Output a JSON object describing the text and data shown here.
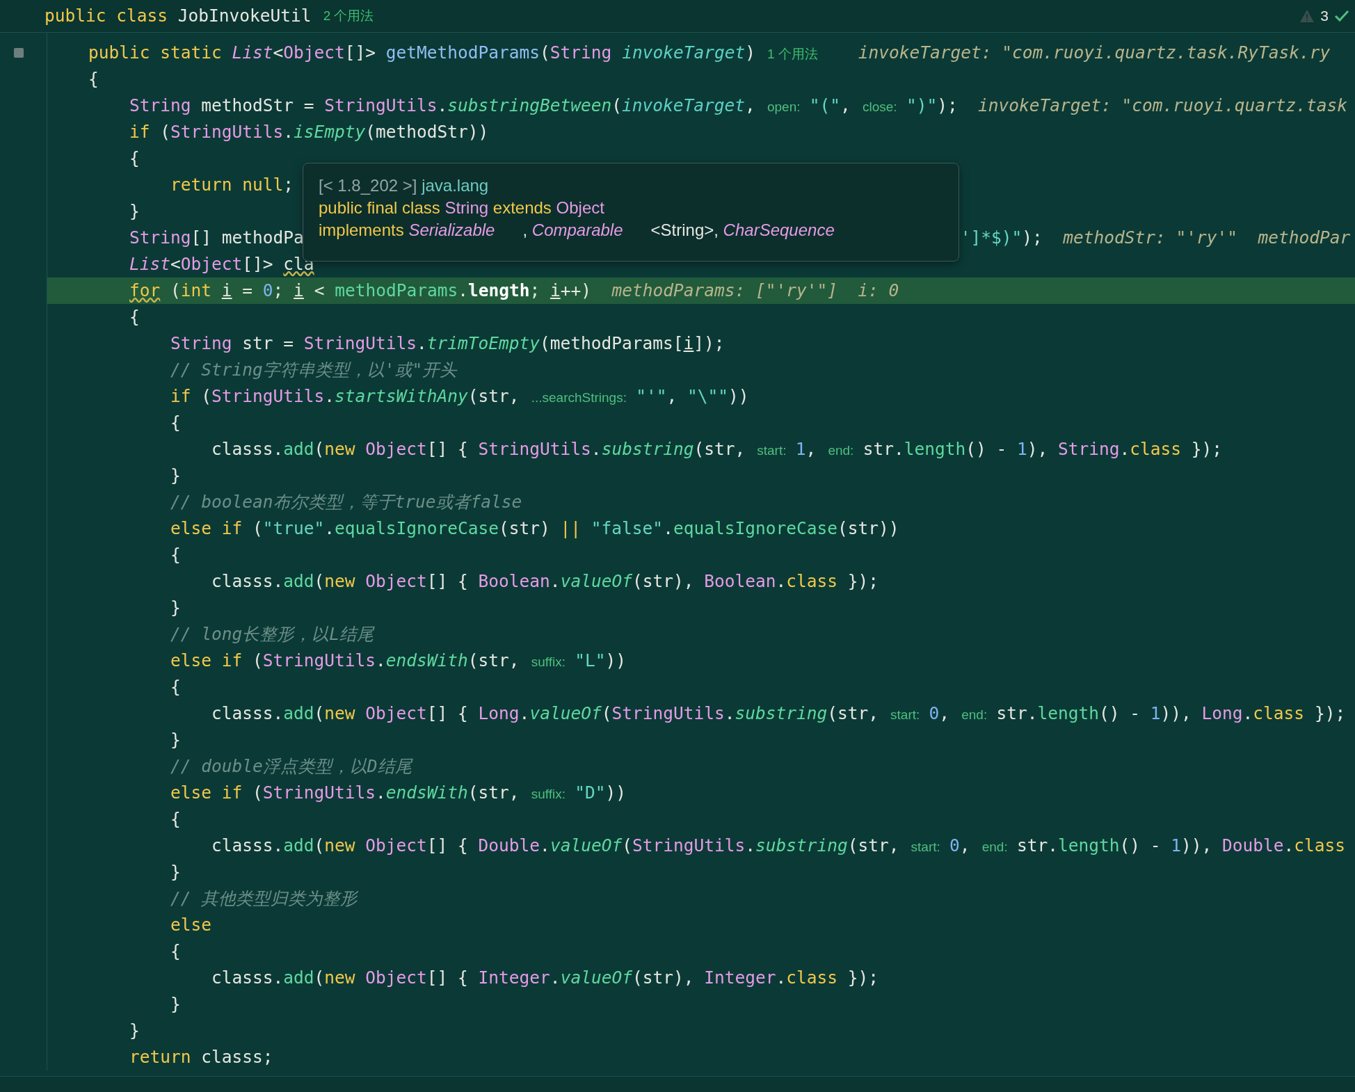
{
  "header": {
    "code": [
      {
        "kind": "kw",
        "text": "public class "
      },
      {
        "kind": "plain",
        "text": "JobInvokeUtil"
      }
    ],
    "usages": "2 个用法",
    "problems": "3"
  },
  "tooltip": {
    "lines": [
      [
        {
          "kind": "dim",
          "text": "[< 1.8_202 >] "
        },
        {
          "kind": "pkg",
          "text": "java.lang"
        }
      ],
      [
        {
          "kind": "kw",
          "text": "public final class "
        },
        {
          "kind": "type",
          "text": "String"
        },
        {
          "kind": "kw",
          "text": " extends "
        },
        {
          "kind": "type",
          "text": "Object"
        }
      ],
      [
        {
          "kind": "kw",
          "text": "implements "
        },
        {
          "kind": "itype",
          "text": "Serializable"
        },
        {
          "kind": "plain",
          "text": "      , "
        },
        {
          "kind": "itype",
          "text": "Comparable"
        },
        {
          "kind": "plain",
          "text": "      <String>, "
        },
        {
          "kind": "itype",
          "text": "CharSequence"
        }
      ]
    ]
  },
  "lines": [
    {
      "highlighted": false,
      "tokens": [
        {
          "kind": "kw",
          "text": "public static "
        },
        {
          "kind": "itype",
          "text": "List"
        },
        {
          "kind": "plain",
          "text": "<"
        },
        {
          "kind": "type",
          "text": "Object"
        },
        {
          "kind": "plain",
          "text": "[]> "
        },
        {
          "kind": "fn",
          "text": "getMethodParams"
        },
        {
          "kind": "plain",
          "text": "("
        },
        {
          "kind": "type",
          "text": "String "
        },
        {
          "kind": "param",
          "text": "invokeTarget"
        },
        {
          "kind": "plain",
          "text": ")"
        },
        {
          "kind": "usage",
          "text": "1 个用法"
        },
        {
          "kind": "dbg",
          "text": "invokeTarget: \"com.ruoyi.quartz.task.RyTask.ry"
        }
      ]
    },
    {
      "highlighted": false,
      "tokens": [
        {
          "kind": "plain",
          "text": "{"
        }
      ],
      "children": [
        {
          "highlighted": false,
          "tokens": [
            {
              "kind": "type",
              "text": "String"
            },
            {
              "kind": "plain",
              "text": " methodStr = "
            },
            {
              "kind": "type",
              "text": "StringUtils"
            },
            {
              "kind": "plain",
              "text": "."
            },
            {
              "kind": "scall",
              "text": "substringBetween"
            },
            {
              "kind": "plain",
              "text": "("
            },
            {
              "kind": "param",
              "text": "invokeTarget"
            },
            {
              "kind": "plain",
              "text": ","
            },
            {
              "kind": "hint",
              "text": "open:"
            },
            {
              "kind": "str",
              "text": "\"(\""
            },
            {
              "kind": "plain",
              "text": ","
            },
            {
              "kind": "hint",
              "text": "close:"
            },
            {
              "kind": "str",
              "text": "\")\""
            },
            {
              "kind": "plain",
              "text": ");"
            },
            {
              "kind": "dbg",
              "text": "invokeTarget: \"com.ruoyi.quartz.task"
            }
          ]
        },
        {
          "highlighted": false,
          "tokens": [
            {
              "kind": "kw",
              "text": "if"
            },
            {
              "kind": "plain",
              "text": " ("
            },
            {
              "kind": "type",
              "text": "StringUtils"
            },
            {
              "kind": "plain",
              "text": "."
            },
            {
              "kind": "scall",
              "text": "isEmpty"
            },
            {
              "kind": "plain",
              "text": "(methodStr))"
            }
          ]
        },
        {
          "highlighted": false,
          "tokens": [
            {
              "kind": "plain",
              "text": "{"
            }
          ],
          "children": [
            {
              "highlighted": false,
              "tokens": [
                {
                  "kind": "kw",
                  "text": "return null"
                },
                {
                  "kind": "plain",
                  "text": ";"
                }
              ]
            }
          ]
        },
        {
          "highlighted": false,
          "tokens": [
            {
              "kind": "plain",
              "text": "}"
            }
          ]
        },
        {
          "highlighted": false,
          "tokens": [
            {
              "kind": "type",
              "text": "String"
            },
            {
              "kind": "plain",
              "text": "[] methodPa"
            },
            {
              "kind": "resume",
              "text": "']*$)\""
            },
            {
              "kind": "plain",
              "text": ");"
            },
            {
              "kind": "dbg",
              "text": "methodStr: \"'ry'\""
            },
            {
              "kind": "dbg",
              "text": "methodPar"
            }
          ]
        },
        {
          "highlighted": false,
          "tokens": [
            {
              "kind": "itype",
              "text": "List"
            },
            {
              "kind": "plain",
              "text": "<"
            },
            {
              "kind": "type",
              "text": "Object"
            },
            {
              "kind": "plain",
              "text": "[]> "
            },
            {
              "kind": "warn",
              "text": "cla"
            }
          ]
        },
        {
          "highlighted": true,
          "tokens": [
            {
              "kind": "warnkw",
              "text": "for"
            },
            {
              "kind": "plain",
              "text": " ("
            },
            {
              "kind": "kw",
              "text": "int "
            },
            {
              "kind": "local",
              "text": "i"
            },
            {
              "kind": "plain",
              "text": " = "
            },
            {
              "kind": "num",
              "text": "0"
            },
            {
              "kind": "plain",
              "text": "; "
            },
            {
              "kind": "local",
              "text": "i"
            },
            {
              "kind": "plain",
              "text": " < "
            },
            {
              "kind": "call",
              "text": "methodParams"
            },
            {
              "kind": "plain",
              "text": "."
            },
            {
              "kind": "field",
              "text": "length"
            },
            {
              "kind": "plain",
              "text": "; "
            },
            {
              "kind": "local",
              "text": "i"
            },
            {
              "kind": "plain",
              "text": "++)"
            },
            {
              "kind": "dbg",
              "text": "methodParams: [\"'ry'\"]"
            },
            {
              "kind": "dbg",
              "text": "i: 0"
            }
          ]
        },
        {
          "highlighted": false,
          "tokens": [
            {
              "kind": "plain",
              "text": "{"
            }
          ],
          "children": [
            {
              "highlighted": false,
              "tokens": [
                {
                  "kind": "type",
                  "text": "String"
                },
                {
                  "kind": "plain",
                  "text": " str = "
                },
                {
                  "kind": "type",
                  "text": "StringUtils"
                },
                {
                  "kind": "plain",
                  "text": "."
                },
                {
                  "kind": "scall",
                  "text": "trimToEmpty"
                },
                {
                  "kind": "plain",
                  "text": "(methodParams["
                },
                {
                  "kind": "local",
                  "text": "i"
                },
                {
                  "kind": "plain",
                  "text": "]);"
                }
              ]
            },
            {
              "highlighted": false,
              "tokens": [
                {
                  "kind": "cmt",
                  "text": "// String字符串类型，以'或\"开头"
                }
              ]
            },
            {
              "highlighted": false,
              "tokens": [
                {
                  "kind": "kw",
                  "text": "if"
                },
                {
                  "kind": "plain",
                  "text": " ("
                },
                {
                  "kind": "type",
                  "text": "StringUtils"
                },
                {
                  "kind": "plain",
                  "text": "."
                },
                {
                  "kind": "scall",
                  "text": "startsWithAny"
                },
                {
                  "kind": "plain",
                  "text": "(str,"
                },
                {
                  "kind": "hint",
                  "text": "...searchStrings:"
                },
                {
                  "kind": "str",
                  "text": "\"'\""
                },
                {
                  "kind": "plain",
                  "text": ", "
                },
                {
                  "kind": "str",
                  "text": "\"\\\"\""
                },
                {
                  "kind": "plain",
                  "text": "))"
                }
              ]
            },
            {
              "highlighted": false,
              "tokens": [
                {
                  "kind": "plain",
                  "text": "{"
                }
              ],
              "children": [
                {
                  "highlighted": false,
                  "tokens": [
                    {
                      "kind": "plain",
                      "text": "classs."
                    },
                    {
                      "kind": "call",
                      "text": "add"
                    },
                    {
                      "kind": "plain",
                      "text": "("
                    },
                    {
                      "kind": "kw",
                      "text": "new "
                    },
                    {
                      "kind": "type",
                      "text": "Object"
                    },
                    {
                      "kind": "plain",
                      "text": "[] { "
                    },
                    {
                      "kind": "type",
                      "text": "StringUtils"
                    },
                    {
                      "kind": "plain",
                      "text": "."
                    },
                    {
                      "kind": "scall",
                      "text": "substring"
                    },
                    {
                      "kind": "plain",
                      "text": "(str,"
                    },
                    {
                      "kind": "hint",
                      "text": "start:"
                    },
                    {
                      "kind": "num",
                      "text": "1"
                    },
                    {
                      "kind": "plain",
                      "text": ","
                    },
                    {
                      "kind": "hint",
                      "text": "end:"
                    },
                    {
                      "kind": "plain",
                      "text": "str."
                    },
                    {
                      "kind": "call",
                      "text": "length"
                    },
                    {
                      "kind": "plain",
                      "text": "() - "
                    },
                    {
                      "kind": "num",
                      "text": "1"
                    },
                    {
                      "kind": "plain",
                      "text": "), "
                    },
                    {
                      "kind": "type",
                      "text": "String"
                    },
                    {
                      "kind": "plain",
                      "text": "."
                    },
                    {
                      "kind": "kw",
                      "text": "class"
                    },
                    {
                      "kind": "plain",
                      "text": " });"
                    }
                  ]
                }
              ]
            },
            {
              "highlighted": false,
              "tokens": [
                {
                  "kind": "plain",
                  "text": "}"
                }
              ]
            },
            {
              "highlighted": false,
              "tokens": [
                {
                  "kind": "cmt",
                  "text": "// boolean布尔类型，等于true或者false"
                }
              ]
            },
            {
              "highlighted": false,
              "tokens": [
                {
                  "kind": "kw",
                  "text": "else if"
                },
                {
                  "kind": "plain",
                  "text": " ("
                },
                {
                  "kind": "str",
                  "text": "\"true\""
                },
                {
                  "kind": "plain",
                  "text": "."
                },
                {
                  "kind": "call",
                  "text": "equalsIgnoreCase"
                },
                {
                  "kind": "plain",
                  "text": "(str) "
                },
                {
                  "kind": "kw",
                  "text": "|| "
                },
                {
                  "kind": "str",
                  "text": "\"false\""
                },
                {
                  "kind": "plain",
                  "text": "."
                },
                {
                  "kind": "call",
                  "text": "equalsIgnoreCase"
                },
                {
                  "kind": "plain",
                  "text": "(str))"
                }
              ]
            },
            {
              "highlighted": false,
              "tokens": [
                {
                  "kind": "plain",
                  "text": "{"
                }
              ],
              "children": [
                {
                  "highlighted": false,
                  "tokens": [
                    {
                      "kind": "plain",
                      "text": "classs."
                    },
                    {
                      "kind": "call",
                      "text": "add"
                    },
                    {
                      "kind": "plain",
                      "text": "("
                    },
                    {
                      "kind": "kw",
                      "text": "new "
                    },
                    {
                      "kind": "type",
                      "text": "Object"
                    },
                    {
                      "kind": "plain",
                      "text": "[] { "
                    },
                    {
                      "kind": "type",
                      "text": "Boolean"
                    },
                    {
                      "kind": "plain",
                      "text": "."
                    },
                    {
                      "kind": "scall",
                      "text": "valueOf"
                    },
                    {
                      "kind": "plain",
                      "text": "(str), "
                    },
                    {
                      "kind": "type",
                      "text": "Boolean"
                    },
                    {
                      "kind": "plain",
                      "text": "."
                    },
                    {
                      "kind": "kw",
                      "text": "class"
                    },
                    {
                      "kind": "plain",
                      "text": " });"
                    }
                  ]
                }
              ]
            },
            {
              "highlighted": false,
              "tokens": [
                {
                  "kind": "plain",
                  "text": "}"
                }
              ]
            },
            {
              "highlighted": false,
              "tokens": [
                {
                  "kind": "cmt",
                  "text": "// long长整形，以L结尾"
                }
              ]
            },
            {
              "highlighted": false,
              "tokens": [
                {
                  "kind": "kw",
                  "text": "else if"
                },
                {
                  "kind": "plain",
                  "text": " ("
                },
                {
                  "kind": "type",
                  "text": "StringUtils"
                },
                {
                  "kind": "plain",
                  "text": "."
                },
                {
                  "kind": "scall",
                  "text": "endsWith"
                },
                {
                  "kind": "plain",
                  "text": "(str,"
                },
                {
                  "kind": "hint",
                  "text": "suffix:"
                },
                {
                  "kind": "str",
                  "text": "\"L\""
                },
                {
                  "kind": "plain",
                  "text": "))"
                }
              ]
            },
            {
              "highlighted": false,
              "tokens": [
                {
                  "kind": "plain",
                  "text": "{"
                }
              ],
              "children": [
                {
                  "highlighted": false,
                  "tokens": [
                    {
                      "kind": "plain",
                      "text": "classs."
                    },
                    {
                      "kind": "call",
                      "text": "add"
                    },
                    {
                      "kind": "plain",
                      "text": "("
                    },
                    {
                      "kind": "kw",
                      "text": "new "
                    },
                    {
                      "kind": "type",
                      "text": "Object"
                    },
                    {
                      "kind": "plain",
                      "text": "[] { "
                    },
                    {
                      "kind": "type",
                      "text": "Long"
                    },
                    {
                      "kind": "plain",
                      "text": "."
                    },
                    {
                      "kind": "scall",
                      "text": "valueOf"
                    },
                    {
                      "kind": "plain",
                      "text": "("
                    },
                    {
                      "kind": "type",
                      "text": "StringUtils"
                    },
                    {
                      "kind": "plain",
                      "text": "."
                    },
                    {
                      "kind": "scall",
                      "text": "substring"
                    },
                    {
                      "kind": "plain",
                      "text": "(str,"
                    },
                    {
                      "kind": "hint",
                      "text": "start:"
                    },
                    {
                      "kind": "num",
                      "text": "0"
                    },
                    {
                      "kind": "plain",
                      "text": ","
                    },
                    {
                      "kind": "hint",
                      "text": "end:"
                    },
                    {
                      "kind": "plain",
                      "text": "str."
                    },
                    {
                      "kind": "call",
                      "text": "length"
                    },
                    {
                      "kind": "plain",
                      "text": "() - "
                    },
                    {
                      "kind": "num",
                      "text": "1"
                    },
                    {
                      "kind": "plain",
                      "text": ")), "
                    },
                    {
                      "kind": "type",
                      "text": "Long"
                    },
                    {
                      "kind": "plain",
                      "text": "."
                    },
                    {
                      "kind": "kw",
                      "text": "class"
                    },
                    {
                      "kind": "plain",
                      "text": " });"
                    }
                  ]
                }
              ]
            },
            {
              "highlighted": false,
              "tokens": [
                {
                  "kind": "plain",
                  "text": "}"
                }
              ]
            },
            {
              "highlighted": false,
              "tokens": [
                {
                  "kind": "cmt",
                  "text": "// double浮点类型，以D结尾"
                }
              ]
            },
            {
              "highlighted": false,
              "tokens": [
                {
                  "kind": "kw",
                  "text": "else if"
                },
                {
                  "kind": "plain",
                  "text": " ("
                },
                {
                  "kind": "type",
                  "text": "StringUtils"
                },
                {
                  "kind": "plain",
                  "text": "."
                },
                {
                  "kind": "scall",
                  "text": "endsWith"
                },
                {
                  "kind": "plain",
                  "text": "(str,"
                },
                {
                  "kind": "hint",
                  "text": "suffix:"
                },
                {
                  "kind": "str",
                  "text": "\"D\""
                },
                {
                  "kind": "plain",
                  "text": "))"
                }
              ]
            },
            {
              "highlighted": false,
              "tokens": [
                {
                  "kind": "plain",
                  "text": "{"
                }
              ],
              "children": [
                {
                  "highlighted": false,
                  "tokens": [
                    {
                      "kind": "plain",
                      "text": "classs."
                    },
                    {
                      "kind": "call",
                      "text": "add"
                    },
                    {
                      "kind": "plain",
                      "text": "("
                    },
                    {
                      "kind": "kw",
                      "text": "new "
                    },
                    {
                      "kind": "type",
                      "text": "Object"
                    },
                    {
                      "kind": "plain",
                      "text": "[] { "
                    },
                    {
                      "kind": "type",
                      "text": "Double"
                    },
                    {
                      "kind": "plain",
                      "text": "."
                    },
                    {
                      "kind": "scall",
                      "text": "valueOf"
                    },
                    {
                      "kind": "plain",
                      "text": "("
                    },
                    {
                      "kind": "type",
                      "text": "StringUtils"
                    },
                    {
                      "kind": "plain",
                      "text": "."
                    },
                    {
                      "kind": "scall",
                      "text": "substring"
                    },
                    {
                      "kind": "plain",
                      "text": "(str,"
                    },
                    {
                      "kind": "hint",
                      "text": "start:"
                    },
                    {
                      "kind": "num",
                      "text": "0"
                    },
                    {
                      "kind": "plain",
                      "text": ","
                    },
                    {
                      "kind": "hint",
                      "text": "end:"
                    },
                    {
                      "kind": "plain",
                      "text": "str."
                    },
                    {
                      "kind": "call",
                      "text": "length"
                    },
                    {
                      "kind": "plain",
                      "text": "() - "
                    },
                    {
                      "kind": "num",
                      "text": "1"
                    },
                    {
                      "kind": "plain",
                      "text": ")), "
                    },
                    {
                      "kind": "type",
                      "text": "Double"
                    },
                    {
                      "kind": "plain",
                      "text": "."
                    },
                    {
                      "kind": "kw",
                      "text": "class"
                    }
                  ]
                }
              ]
            },
            {
              "highlighted": false,
              "tokens": [
                {
                  "kind": "plain",
                  "text": "}"
                }
              ]
            },
            {
              "highlighted": false,
              "tokens": [
                {
                  "kind": "cmt",
                  "text": "// 其他类型归类为整形"
                }
              ]
            },
            {
              "highlighted": false,
              "tokens": [
                {
                  "kind": "kw",
                  "text": "else"
                }
              ]
            },
            {
              "highlighted": false,
              "tokens": [
                {
                  "kind": "plain",
                  "text": "{"
                }
              ],
              "children": [
                {
                  "highlighted": false,
                  "tokens": [
                    {
                      "kind": "plain",
                      "text": "classs."
                    },
                    {
                      "kind": "call",
                      "text": "add"
                    },
                    {
                      "kind": "plain",
                      "text": "("
                    },
                    {
                      "kind": "kw",
                      "text": "new "
                    },
                    {
                      "kind": "type",
                      "text": "Object"
                    },
                    {
                      "kind": "plain",
                      "text": "[] { "
                    },
                    {
                      "kind": "type",
                      "text": "Integer"
                    },
                    {
                      "kind": "plain",
                      "text": "."
                    },
                    {
                      "kind": "scall",
                      "text": "valueOf"
                    },
                    {
                      "kind": "plain",
                      "text": "(str), "
                    },
                    {
                      "kind": "type",
                      "text": "Integer"
                    },
                    {
                      "kind": "plain",
                      "text": "."
                    },
                    {
                      "kind": "kw",
                      "text": "class"
                    },
                    {
                      "kind": "plain",
                      "text": " });"
                    }
                  ]
                }
              ]
            },
            {
              "highlighted": false,
              "tokens": [
                {
                  "kind": "plain",
                  "text": "}"
                }
              ]
            }
          ]
        },
        {
          "highlighted": false,
          "tokens": [
            {
              "kind": "plain",
              "text": "}"
            }
          ]
        },
        {
          "highlighted": false,
          "tokens": [
            {
              "kind": "kw",
              "text": "return"
            },
            {
              "kind": "plain",
              "text": " classs;"
            }
          ]
        }
      ]
    }
  ]
}
